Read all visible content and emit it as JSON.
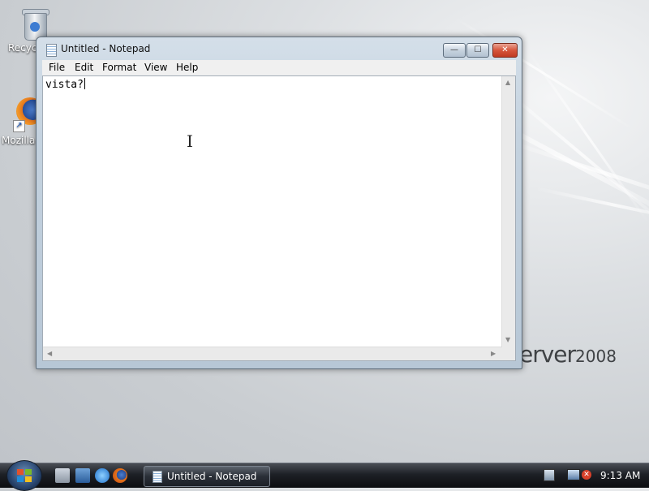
{
  "desktop": {
    "icons": [
      {
        "label": "Recycle Bin"
      },
      {
        "label": "Mozilla Firefox"
      }
    ],
    "branding": {
      "text": "erver",
      "year": "2008"
    }
  },
  "window": {
    "title": "Untitled - Notepad",
    "controls": {
      "minimize": "—",
      "maximize": "☐",
      "close": "✕"
    },
    "menu": [
      "File",
      "Edit",
      "Format",
      "View",
      "Help"
    ],
    "content": "vista?"
  },
  "taskbar": {
    "start_icon": "windows-logo",
    "quick_launch": [
      "show-desktop-icon",
      "switch-windows-icon",
      "internet-explorer-icon",
      "firefox-icon"
    ],
    "task_button_label": "Untitled - Notepad",
    "tray_icons": [
      "network-icon",
      "volume-muted-icon"
    ],
    "clock": "9:13 AM"
  }
}
